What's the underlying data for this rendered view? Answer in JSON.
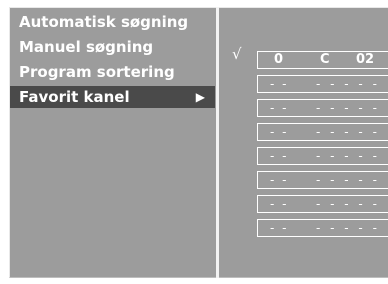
{
  "menu": {
    "items": [
      {
        "label": "Automatisk søgning",
        "selected": false
      },
      {
        "label": "Manuel søgning",
        "selected": false
      },
      {
        "label": "Program sortering",
        "selected": false
      },
      {
        "label": "Favorit kanel",
        "selected": true,
        "arrow": "▶"
      }
    ]
  },
  "favorites": {
    "check_mark": "√",
    "active": {
      "number": "0",
      "band": "C",
      "channel": "02"
    },
    "empty_rows": [
      {
        "a": "- -",
        "b": "- - - - -"
      },
      {
        "a": "- -",
        "b": "- - - - -"
      },
      {
        "a": "- -",
        "b": "- - - - -"
      },
      {
        "a": "- -",
        "b": "- - - - -"
      },
      {
        "a": "- -",
        "b": "- - - - -"
      },
      {
        "a": "- -",
        "b": "- - - - -"
      },
      {
        "a": "- -",
        "b": "- - - - -"
      }
    ]
  },
  "colors": {
    "panel_bg": "#9c9c9c",
    "selected_bg": "#4a4a4a",
    "text": "#ffffff"
  }
}
